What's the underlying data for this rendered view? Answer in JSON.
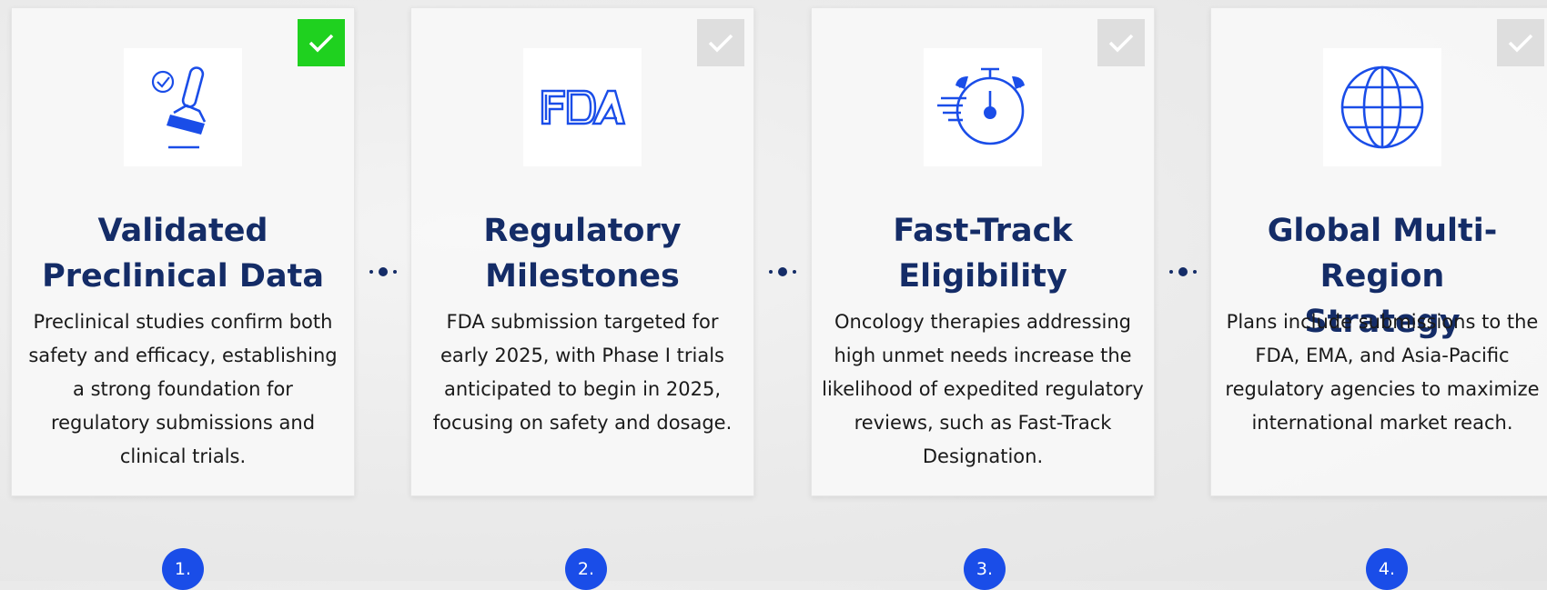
{
  "accent_color": "#1a4de8",
  "title_color": "#142c67",
  "check_active_color": "#1fd11f",
  "check_inactive_color": "#dedede",
  "steps": [
    {
      "icon": "stamp-icon",
      "title": "Validated\nPreclinical Data",
      "description": "Preclinical studies confirm both safety and efficacy, establishing a strong foundation for regulatory submissions and clinical trials.",
      "number": "1.",
      "checked": true
    },
    {
      "icon": "fda-logo-icon",
      "title": "Regulatory\nMilestones",
      "description": "FDA submission targeted for early 2025, with Phase I trials anticipated to begin in 2025, focusing on safety and dosage.",
      "number": "2.",
      "checked": false
    },
    {
      "icon": "stopwatch-icon",
      "title": "Fast-Track\nEligibility",
      "description": "Oncology therapies addressing high unmet needs increase the likelihood of expedited regulatory reviews, such as Fast-Track Designation.",
      "number": "3.",
      "checked": false
    },
    {
      "icon": "globe-icon",
      "title": "Global Multi-Region\nStrategy",
      "description": "Plans include submissions to the FDA, EMA, and Asia-Pacific regulatory agencies to maximize international market reach.",
      "number": "4.",
      "checked": false
    }
  ]
}
